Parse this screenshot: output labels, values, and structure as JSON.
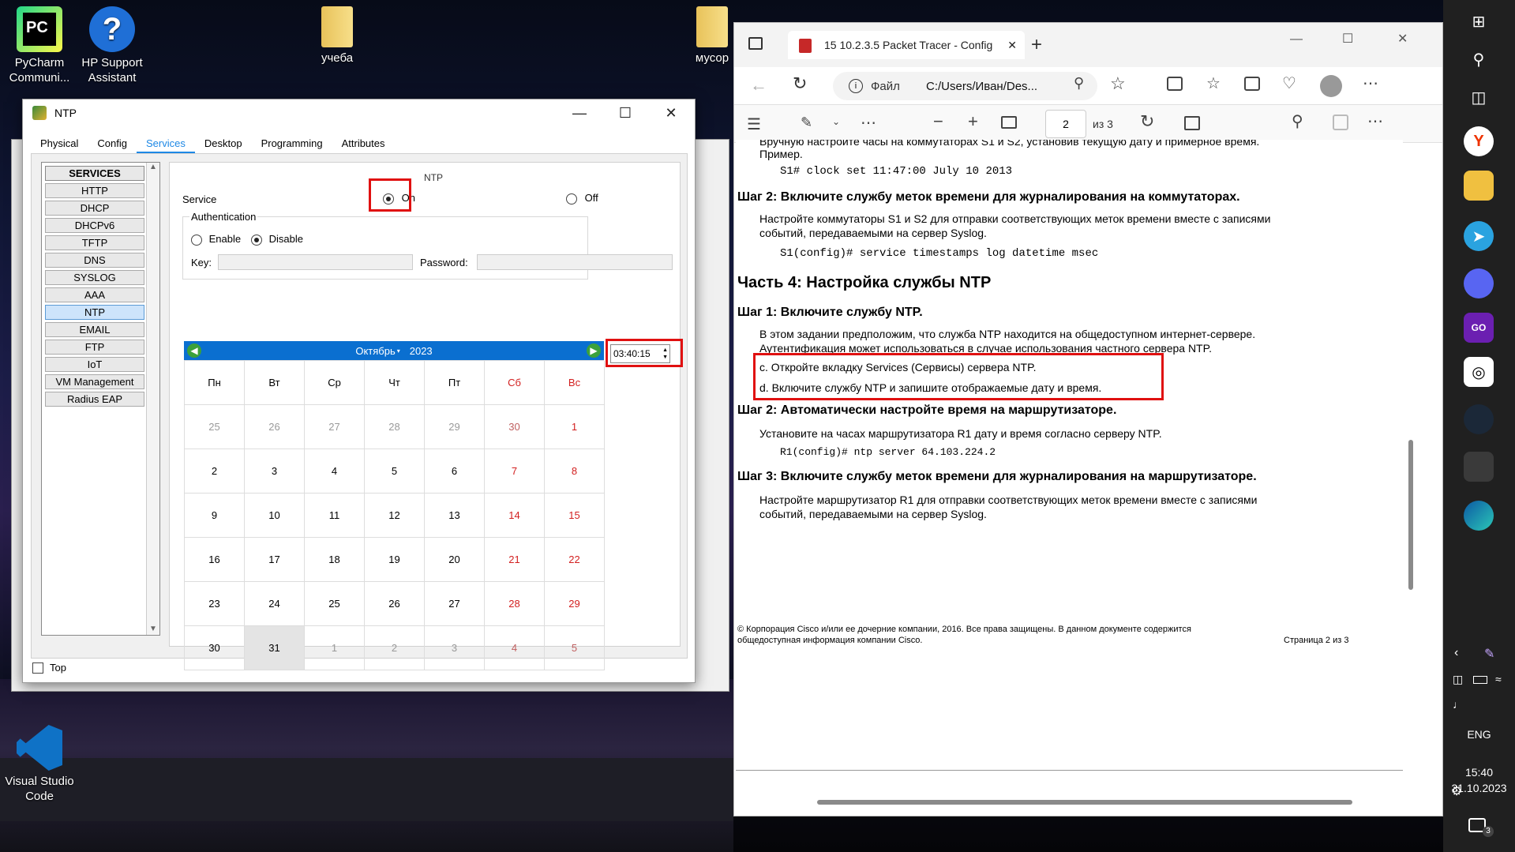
{
  "desktop": {
    "icons": [
      {
        "label1": "PyCharm",
        "label2": "Communi..."
      },
      {
        "label1": "HP Support",
        "label2": "Assistant"
      },
      {
        "label1": "учеба",
        "label2": ""
      },
      {
        "label1": "мусор",
        "label2": ""
      },
      {
        "label1": "Visual Studio",
        "label2": "Code"
      }
    ]
  },
  "ntp": {
    "title": "NTP",
    "tabs": [
      "Physical",
      "Config",
      "Services",
      "Desktop",
      "Programming",
      "Attributes"
    ],
    "services_header": "SERVICES",
    "services": [
      "HTTP",
      "DHCP",
      "DHCPv6",
      "TFTP",
      "DNS",
      "SYSLOG",
      "AAA",
      "NTP",
      "EMAIL",
      "FTP",
      "IoT",
      "VM Management",
      "Radius EAP"
    ],
    "section_title": "NTP",
    "service_label": "Service",
    "on_label": "On",
    "off_label": "Off",
    "auth_label": "Authentication",
    "enable_label": "Enable",
    "disable_label": "Disable",
    "key_label": "Key:",
    "password_label": "Password:",
    "month": "Октябрь",
    "year": "2023",
    "time": "03:40:15",
    "weekdays": [
      "Пн",
      "Вт",
      "Ср",
      "Чт",
      "Пт",
      "Сб",
      "Вс"
    ],
    "days": [
      [
        "25",
        "26",
        "27",
        "28",
        "29",
        "30",
        "1"
      ],
      [
        "2",
        "3",
        "4",
        "5",
        "6",
        "7",
        "8"
      ],
      [
        "9",
        "10",
        "11",
        "12",
        "13",
        "14",
        "15"
      ],
      [
        "16",
        "17",
        "18",
        "19",
        "20",
        "21",
        "22"
      ],
      [
        "23",
        "24",
        "25",
        "26",
        "27",
        "28",
        "29"
      ],
      [
        "30",
        "31",
        "1",
        "2",
        "3",
        "4",
        "5"
      ]
    ],
    "top_label": "Top"
  },
  "browser": {
    "tab_title": "15 10.2.3.5 Packet Tracer - Config",
    "addr_prefix": "Файл",
    "addr": "C:/Users/Иван/Des...",
    "page_num": "2",
    "page_of": "из 3",
    "doc": {
      "l0": "Вручную настройте часы на коммутаторах S1 и S2, установив текущую дату и примерное время.",
      "l0b": "Пример.",
      "c1": "S1# clock set 11:47:00 July 10 2013",
      "s2": "Шаг 2:    Включите службу меток времени для журналирования на коммутаторах.",
      "p2a": "Настройте коммутаторы S1 и S2 для отправки соответствующих меток времени вместе с записями",
      "p2b": "событий, передаваемыми на сервер Syslog.",
      "c2": "S1(config)# service timestamps log datetime msec",
      "part4": "Часть 4:    Настройка службы NTP",
      "s41": "Шаг 1:    Включите службу NTP.",
      "p41a": "В этом задании предположим, что служба NTP находится на общедоступном интернет-сервере.",
      "p41b": "Аутентификация может использоваться в случае использования частного сервера NTP.",
      "lc": "c.    Откройте вкладку Services (Сервисы) сервера NTP.",
      "ld": "d.    Включите службу NTP и запишите отображаемые дату и время.",
      "s42": "Шаг 2:    Автоматически настройте время на маршрутизаторе.",
      "p42": "Установите на часах маршрутизатора R1 дату и время согласно серверу NTP.",
      "c3": "R1(config)# ntp server 64.103.224.2",
      "s43": "Шаг 3:    Включите службу меток времени для журналирования на маршрутизаторе.",
      "p43a": "Настройте маршрутизатор R1 для отправки соответствующих меток времени вместе с записями",
      "p43b": "событий, передаваемыми на сервер Syslog.",
      "foot1": "© Корпорация Cisco и/или ее дочерние компании, 2016. Все права защищены. В данном документе содержится",
      "foot2": "общедоступная информация компании Cisco.",
      "pageinfo": "Страница 2 из 3"
    }
  },
  "taskbar": {
    "lang": "ENG",
    "time": "15:40",
    "date": "31.10.2023",
    "notif": "3"
  }
}
